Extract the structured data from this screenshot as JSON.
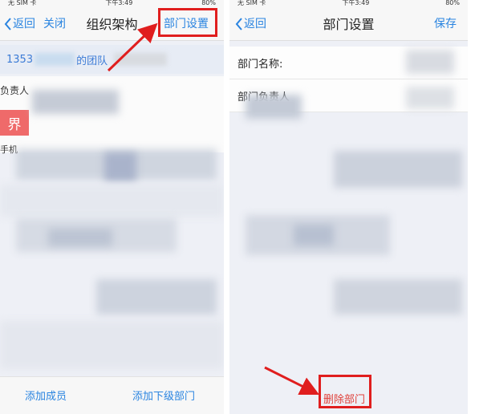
{
  "left_screen": {
    "status": {
      "carrier": "无 SIM 卡",
      "time": "下午3:49",
      "battery": "80%"
    },
    "nav": {
      "back_label": "返回",
      "close_label": "关闭",
      "title": "组织架构",
      "settings_label": "部门设置"
    },
    "team_bar": {
      "prefix": "1353",
      "suffix": "的团队"
    },
    "leader_label": "负责人",
    "avatar_char": "界",
    "phone_label": "手机",
    "bottom": {
      "add_member": "添加成员",
      "add_sub_dept": "添加下级部门"
    }
  },
  "right_screen": {
    "status": {
      "carrier": "无 SIM 卡",
      "time": "下午3:49",
      "battery": "80%"
    },
    "nav": {
      "back_label": "返回",
      "title": "部门设置",
      "save_label": "保存"
    },
    "form": {
      "name_label": "部门名称:",
      "leader_label": "部门负责人"
    },
    "delete_label": "删除部门"
  },
  "colors": {
    "accent": "#2a84e0",
    "annotation_red": "#e01e1e",
    "avatar_red": "#ef6a6a",
    "page_bg": "#eef0f6"
  },
  "icons": [
    "chevron-left-icon",
    "red-arrow-annotation"
  ]
}
